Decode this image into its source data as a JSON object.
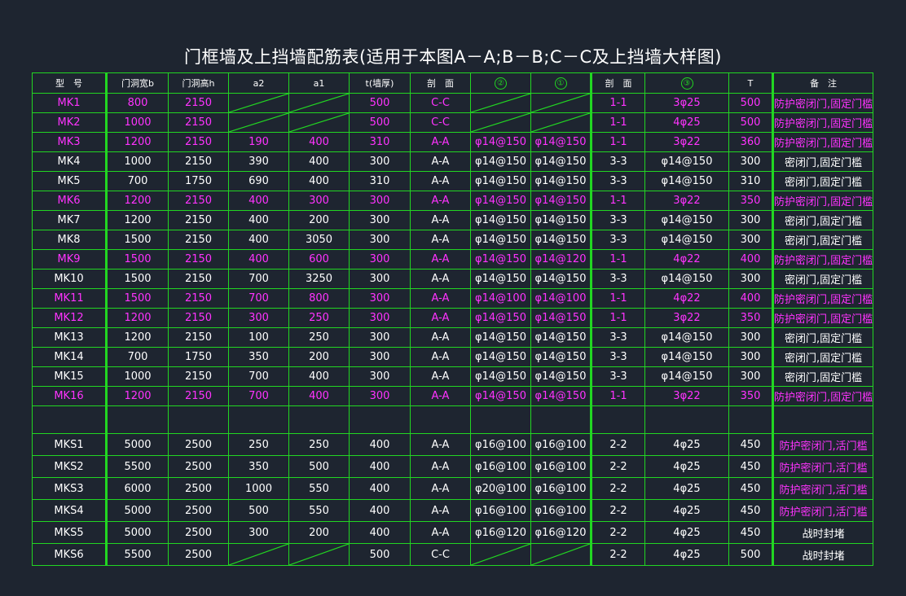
{
  "title": "门框墙及上挡墙配筋表(适用于本图A－A;B－B;C－C及上挡墙大样图)",
  "headers": [
    "型　号",
    "门洞宽b",
    "门洞高h",
    "a2",
    "a1",
    "t(墙厚)",
    "剖　面",
    "②",
    "①",
    "剖　面",
    "③",
    "T",
    "备　注"
  ],
  "colors": {
    "grid": "#22d622",
    "magenta": "#ff33ff",
    "text": "#ffffff",
    "background": "#1e2530"
  },
  "rows_group1": [
    {
      "c": [
        "MK1",
        "800",
        "2150",
        "",
        "",
        "500",
        "C-C",
        "",
        "",
        "1-1",
        "3φ25",
        "500",
        "防护密闭门,固定门槛"
      ],
      "magenta": true
    },
    {
      "c": [
        "MK2",
        "1000",
        "2150",
        "",
        "",
        "500",
        "C-C",
        "",
        "",
        "1-1",
        "4φ25",
        "500",
        "防护密闭门,固定门槛"
      ],
      "magenta": true
    },
    {
      "c": [
        "MK3",
        "1200",
        "2150",
        "190",
        "400",
        "310",
        "A-A",
        "φ14@150",
        "φ14@150",
        "1-1",
        "3φ22",
        "360",
        "防护密闭门,固定门槛"
      ],
      "magenta": true
    },
    {
      "c": [
        "MK4",
        "1000",
        "2150",
        "390",
        "400",
        "300",
        "A-A",
        "φ14@150",
        "φ14@150",
        "3-3",
        "φ14@150",
        "300",
        "密闭门,固定门槛"
      ],
      "magenta": false
    },
    {
      "c": [
        "MK5",
        "700",
        "1750",
        "690",
        "400",
        "310",
        "A-A",
        "φ14@150",
        "φ14@150",
        "3-3",
        "φ14@150",
        "310",
        "密闭门,固定门槛"
      ],
      "magenta": false
    },
    {
      "c": [
        "MK6",
        "1200",
        "2150",
        "400",
        "300",
        "300",
        "A-A",
        "φ14@150",
        "φ14@150",
        "1-1",
        "3φ22",
        "350",
        "防护密闭门,固定门槛"
      ],
      "magenta": true
    },
    {
      "c": [
        "MK7",
        "1200",
        "2150",
        "400",
        "200",
        "300",
        "A-A",
        "φ14@150",
        "φ14@150",
        "3-3",
        "φ14@150",
        "300",
        "密闭门,固定门槛"
      ],
      "magenta": false
    },
    {
      "c": [
        "MK8",
        "1500",
        "2150",
        "400",
        "3050",
        "300",
        "A-A",
        "φ14@150",
        "φ14@150",
        "3-3",
        "φ14@150",
        "300",
        "密闭门,固定门槛"
      ],
      "magenta": false
    },
    {
      "c": [
        "MK9",
        "1500",
        "2150",
        "400",
        "600",
        "300",
        "A-A",
        "φ14@150",
        "φ14@120",
        "1-1",
        "4φ22",
        "400",
        "防护密闭门,固定门槛"
      ],
      "magenta": true
    },
    {
      "c": [
        "MK10",
        "1500",
        "2150",
        "700",
        "3250",
        "300",
        "A-A",
        "φ14@150",
        "φ14@150",
        "3-3",
        "φ14@150",
        "300",
        "密闭门,固定门槛"
      ],
      "magenta": false
    },
    {
      "c": [
        "MK11",
        "1500",
        "2150",
        "700",
        "800",
        "300",
        "A-A",
        "φ14@100",
        "φ14@100",
        "1-1",
        "4φ22",
        "400",
        "防护密闭门,固定门槛"
      ],
      "magenta": true
    },
    {
      "c": [
        "MK12",
        "1200",
        "2150",
        "300",
        "250",
        "300",
        "A-A",
        "φ14@150",
        "φ14@150",
        "1-1",
        "3φ22",
        "350",
        "防护密闭门,固定门槛"
      ],
      "magenta": true
    },
    {
      "c": [
        "MK13",
        "1200",
        "2150",
        "100",
        "250",
        "300",
        "A-A",
        "φ14@150",
        "φ14@150",
        "3-3",
        "φ14@150",
        "300",
        "密闭门,固定门槛"
      ],
      "magenta": false
    },
    {
      "c": [
        "MK14",
        "700",
        "1750",
        "350",
        "200",
        "300",
        "A-A",
        "φ14@150",
        "φ14@150",
        "3-3",
        "φ14@150",
        "300",
        "密闭门,固定门槛"
      ],
      "magenta": false
    },
    {
      "c": [
        "MK15",
        "1000",
        "2150",
        "700",
        "400",
        "300",
        "A-A",
        "φ14@150",
        "φ14@150",
        "3-3",
        "φ14@150",
        "300",
        "密闭门,固定门槛"
      ],
      "magenta": false
    },
    {
      "c": [
        "MK16",
        "1200",
        "2150",
        "700",
        "400",
        "300",
        "A-A",
        "φ14@150",
        "φ14@150",
        "1-1",
        "3φ22",
        "350",
        "防护密闭门,固定门槛"
      ],
      "magenta": true
    }
  ],
  "rows_group2": [
    {
      "c": [
        "MKS1",
        "5000",
        "2500",
        "250",
        "250",
        "400",
        "A-A",
        "φ16@100",
        "φ16@100",
        "2-2",
        "4φ25",
        "450",
        "防护密闭门,活门槛"
      ],
      "note_magenta": true
    },
    {
      "c": [
        "MKS2",
        "5500",
        "2500",
        "350",
        "500",
        "400",
        "A-A",
        "φ16@100",
        "φ16@100",
        "2-2",
        "4φ25",
        "450",
        "防护密闭门,活门槛"
      ],
      "note_magenta": true
    },
    {
      "c": [
        "MKS3",
        "6000",
        "2500",
        "1000",
        "550",
        "400",
        "A-A",
        "φ20@100",
        "φ16@100",
        "2-2",
        "4φ25",
        "450",
        "防护密闭门,活门槛"
      ],
      "note_magenta": true
    },
    {
      "c": [
        "MKS4",
        "5000",
        "2500",
        "500",
        "550",
        "400",
        "A-A",
        "φ16@100",
        "φ16@100",
        "2-2",
        "4φ25",
        "450",
        "防护密闭门,活门槛"
      ],
      "note_magenta": true
    },
    {
      "c": [
        "MKS5",
        "5000",
        "2500",
        "300",
        "200",
        "400",
        "A-A",
        "φ16@120",
        "φ16@120",
        "2-2",
        "4φ25",
        "450",
        "战时封堵"
      ],
      "note_magenta": false
    },
    {
      "c": [
        "MKS6",
        "5500",
        "2500",
        "",
        "",
        "500",
        "C-C",
        "",
        "",
        "2-2",
        "4φ25",
        "500",
        "战时封堵"
      ],
      "note_magenta": false
    }
  ]
}
